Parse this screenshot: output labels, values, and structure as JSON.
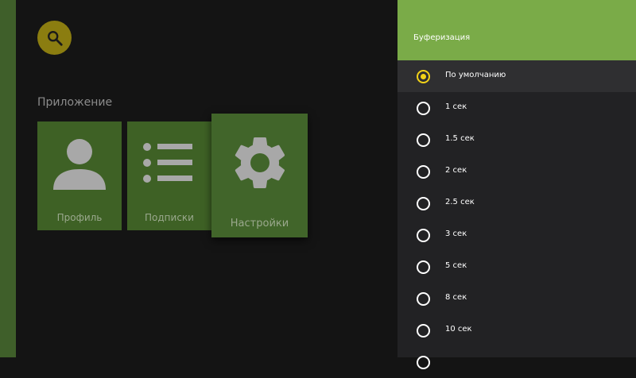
{
  "app": {
    "section_title": "Приложение",
    "tiles": [
      {
        "label": "Профиль",
        "icon": "person-icon"
      },
      {
        "label": "Подписки",
        "icon": "list-icon"
      },
      {
        "label": "Настройки",
        "icon": "gear-icon"
      }
    ],
    "search_icon": "search-icon"
  },
  "panel": {
    "title": "Буферизация",
    "options": [
      {
        "label": "По умолчанию",
        "selected": true
      },
      {
        "label": "1 сек",
        "selected": false
      },
      {
        "label": "1.5 сек",
        "selected": false
      },
      {
        "label": "2 сек",
        "selected": false
      },
      {
        "label": "2.5 сек",
        "selected": false
      },
      {
        "label": "3 сек",
        "selected": false
      },
      {
        "label": "5 сек",
        "selected": false
      },
      {
        "label": "8 сек",
        "selected": false
      },
      {
        "label": "10 сек",
        "selected": false
      }
    ]
  },
  "colors": {
    "header": "#7aab48",
    "tile": "#3e6125",
    "accent": "#f2d218",
    "search_button": "#8b7d10"
  }
}
